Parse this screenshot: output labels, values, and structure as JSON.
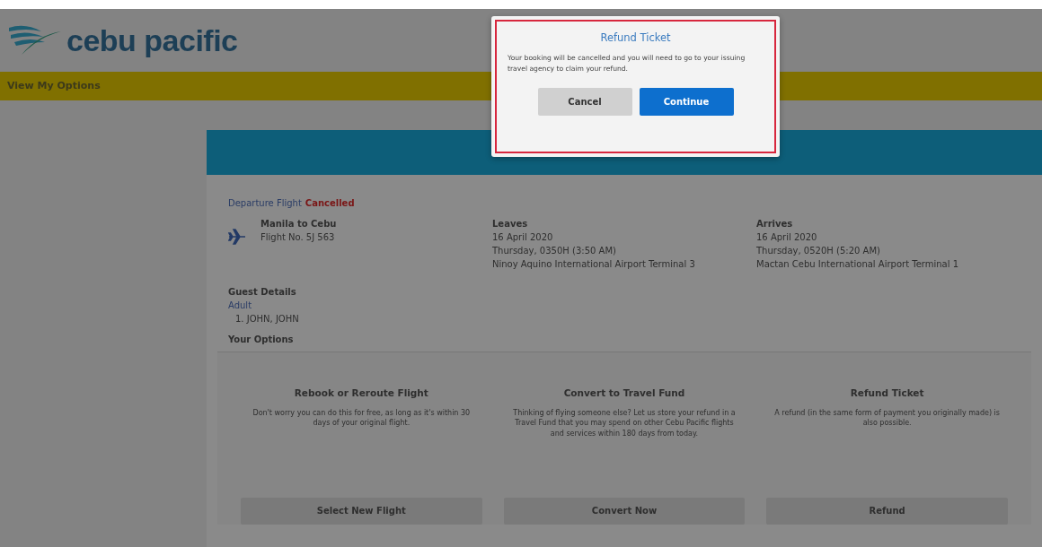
{
  "header": {
    "logo_text": "cebu pacific"
  },
  "nav_bar": {
    "title": "View My Options"
  },
  "flight": {
    "label": "Departure Flight",
    "status": "Cancelled",
    "route": "Manila to Cebu",
    "flight_no": "Flight No. 5J 563",
    "legs": [
      {
        "heading": "Leaves",
        "date": "16 April 2020",
        "time": "Thursday, 0350H (3:50 AM)",
        "airport": "Ninoy Aquino International Airport Terminal 3"
      },
      {
        "heading": "Arrives",
        "date": "16 April 2020",
        "time": "Thursday, 0520H (5:20 AM)",
        "airport": "Mactan Cebu International Airport Terminal 1"
      }
    ]
  },
  "guests": {
    "title": "Guest Details",
    "type": "Adult",
    "names": [
      "1. JOHN, JOHN"
    ]
  },
  "options": {
    "title": "Your Options",
    "items": [
      {
        "title": "Rebook or Reroute Flight",
        "description": "Don't worry you can do this for free, as long as it's within 30 days of your original flight.",
        "button": "Select New Flight"
      },
      {
        "title": "Convert to Travel Fund",
        "description": "Thinking of flying someone else? Let us store your refund in a Travel Fund that you may spend on other Cebu Pacific flights and services within 180 days from today.",
        "button": "Convert Now"
      },
      {
        "title": "Refund Ticket",
        "description": "A refund (in the same form of payment you originally made) is also possible.",
        "button": "Refund"
      }
    ]
  },
  "dialog": {
    "title": "Refund Ticket",
    "message": "Your booking will be cancelled and you will need to go to your issuing travel agency to claim your refund.",
    "buttons": [
      {
        "label": "Cancel",
        "kind": "secondary"
      },
      {
        "label": "Continue",
        "kind": "primary"
      }
    ]
  }
}
